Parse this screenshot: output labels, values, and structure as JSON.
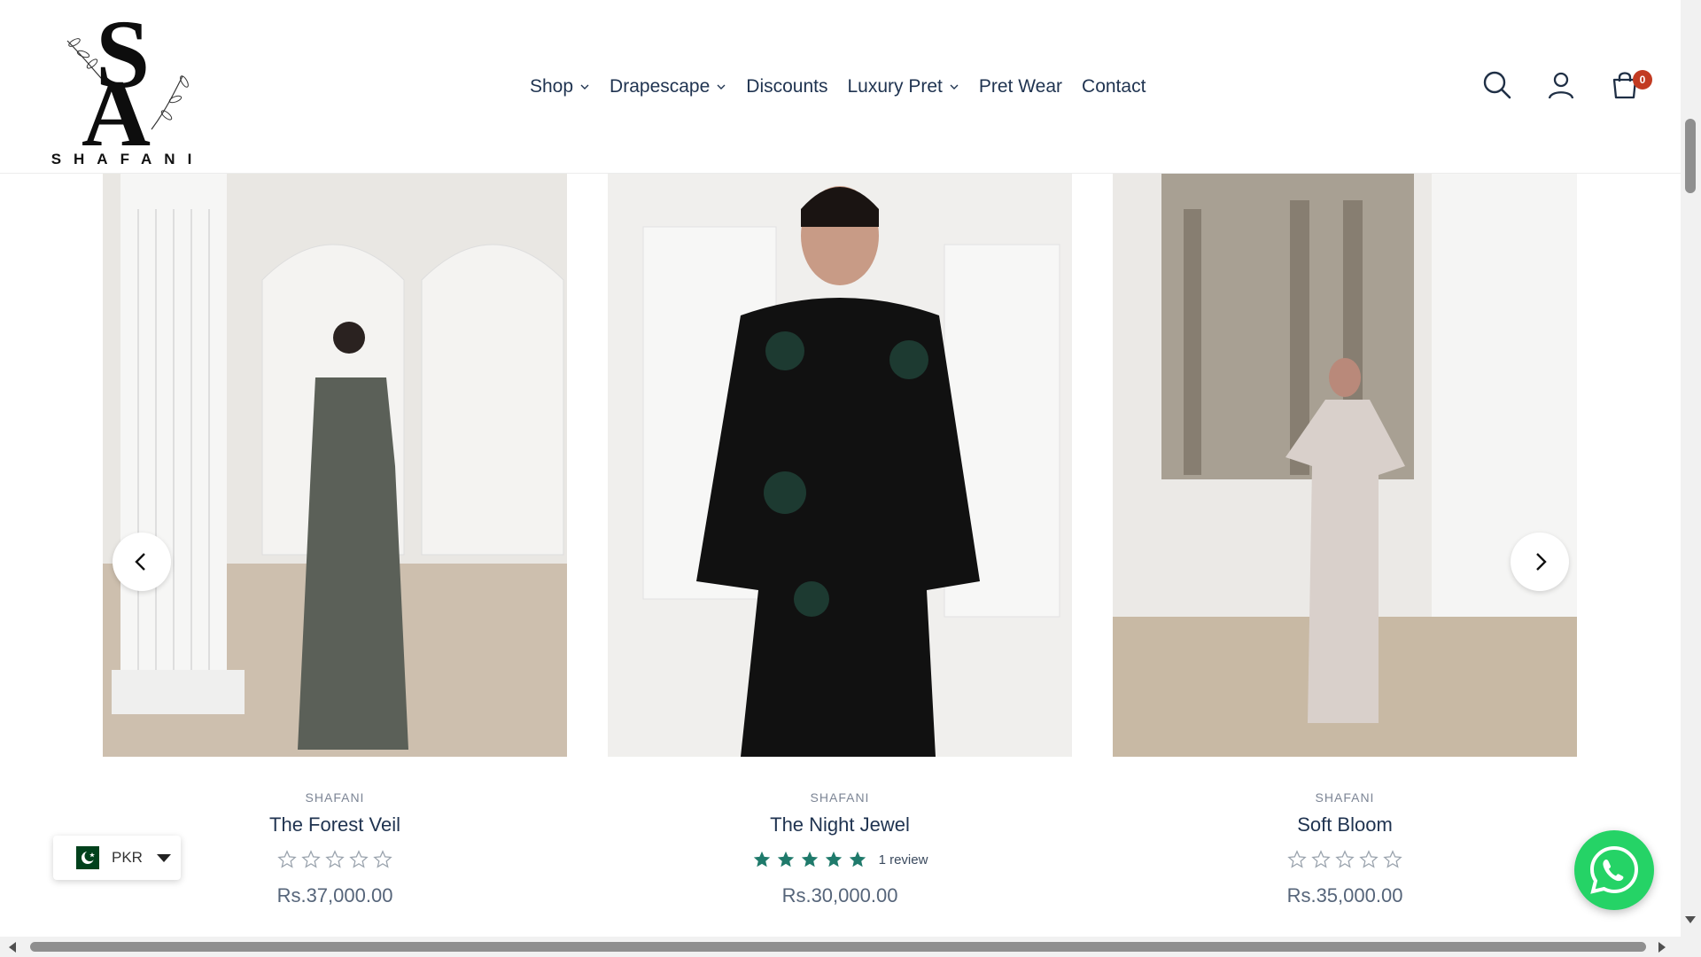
{
  "brand": {
    "logo_monogram": "SA",
    "logo_wordmark": "SHAFANI"
  },
  "nav": {
    "items": [
      {
        "label": "Shop",
        "has_dropdown": true
      },
      {
        "label": "Drapescape",
        "has_dropdown": true
      },
      {
        "label": "Discounts",
        "has_dropdown": false
      },
      {
        "label": "Luxury Pret",
        "has_dropdown": true
      },
      {
        "label": "Pret Wear",
        "has_dropdown": false
      },
      {
        "label": "Contact",
        "has_dropdown": false
      }
    ]
  },
  "header_icons": {
    "search": "search-icon",
    "account": "user-icon",
    "cart": "cart-icon",
    "cart_count": "0"
  },
  "products": [
    {
      "vendor": "SHAFANI",
      "title": "The Forest Veil",
      "rating": 0,
      "stars_max": 5,
      "review_text": "",
      "price": "Rs.37,000.00",
      "dress_color": "#5b6058"
    },
    {
      "vendor": "SHAFANI",
      "title": "The Night Jewel",
      "rating": 5,
      "stars_max": 5,
      "review_text": "1 review",
      "price": "Rs.30,000.00",
      "dress_color": "#111111"
    },
    {
      "vendor": "SHAFANI",
      "title": "Soft Bloom",
      "rating": 0,
      "stars_max": 5,
      "review_text": "",
      "price": "Rs.35,000.00",
      "dress_color": "#d9d0cb"
    }
  ],
  "carousel": {
    "prev": "chevron-left-icon",
    "next": "chevron-right-icon"
  },
  "currency": {
    "code": "PKR",
    "flag": "pakistan-flag-icon"
  },
  "colors": {
    "accent_star": "#1f7a6b",
    "badge": "#c23b22",
    "whatsapp": "#25d366",
    "nav_text": "#1f3350"
  }
}
